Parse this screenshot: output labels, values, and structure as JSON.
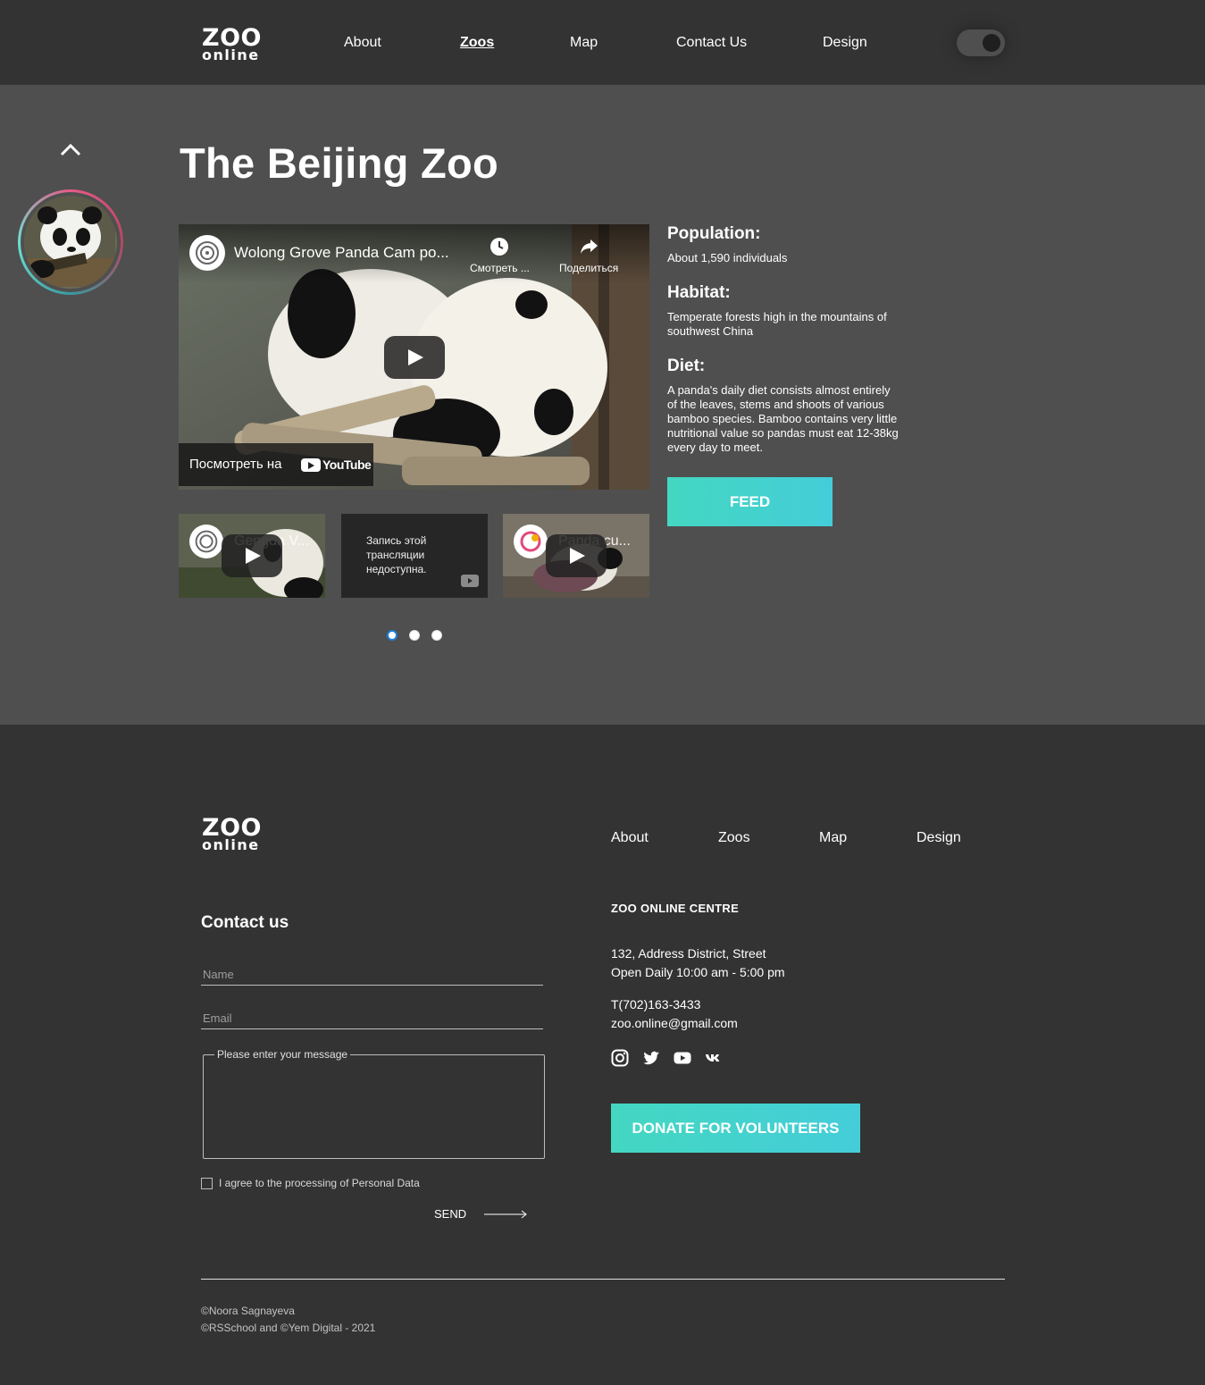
{
  "header": {
    "logo": {
      "line1": "ZOO",
      "line2": "online"
    },
    "nav": [
      {
        "label": "About",
        "active": false
      },
      {
        "label": "Zoos",
        "active": true
      },
      {
        "label": "Map",
        "active": false
      },
      {
        "label": "Contact Us",
        "active": false
      },
      {
        "label": "Design",
        "active": false
      }
    ],
    "theme_toggle": {
      "on": true
    }
  },
  "main": {
    "title": "The Beijing Zoo",
    "video": {
      "title": "Wolong Grove Panda Cam po...",
      "watch_later": "Смотреть ...",
      "share": "Поделиться",
      "watch_on": "Посмотреть на",
      "youtube": "YouTube"
    },
    "thumbs": [
      {
        "title": "Gengda V...",
        "available": true
      },
      {
        "text": "Запись этой трансляции недоступна.",
        "available": false
      },
      {
        "title": "Panda cu...",
        "available": true
      }
    ],
    "carousel": {
      "count": 3,
      "active": 0
    },
    "info": {
      "population_label": "Population:",
      "population": "About 1,590 individuals",
      "habitat_label": "Habitat:",
      "habitat": "Temperate forests high in the mountains of southwest China",
      "diet_label": "Diet:",
      "diet": "A panda's daily diet consists almost entirely of the leaves, stems and shoots of various bamboo species. Bamboo contains very little nutritional value so pandas must eat 12-38kg every day to meet."
    },
    "feed_label": "FEED"
  },
  "footer": {
    "logo": {
      "line1": "ZOO",
      "line2": "online"
    },
    "nav": [
      "About",
      "Zoos",
      "Map",
      "Design"
    ],
    "contact_title": "Contact us",
    "name_placeholder": "Name",
    "email_placeholder": "Email",
    "message_label": "Please enter your message",
    "agree_label": "I agree to the processing of Personal Data",
    "send_label": "SEND",
    "centre_title": "ZOO ONLINE CENTRE",
    "address": "132, Address District, Street",
    "hours": "Open Daily 10:00 am - 5:00 pm",
    "phone": "T(702)163-3433",
    "email": "zoo.online@gmail.com",
    "socials": [
      "instagram-icon",
      "twitter-icon",
      "youtube-icon",
      "vk-icon"
    ],
    "donate_label": "DONATE FOR VOLUNTEERS",
    "copyright1": "©Noora Sagnayeva",
    "copyright2": "©RSSchool and ©Yem Digital - 2021"
  },
  "colors": {
    "header_bg": "#333333",
    "main_bg": "#4f4f4f",
    "accent_from": "#44d7c1",
    "accent_to": "#44cdd9"
  }
}
